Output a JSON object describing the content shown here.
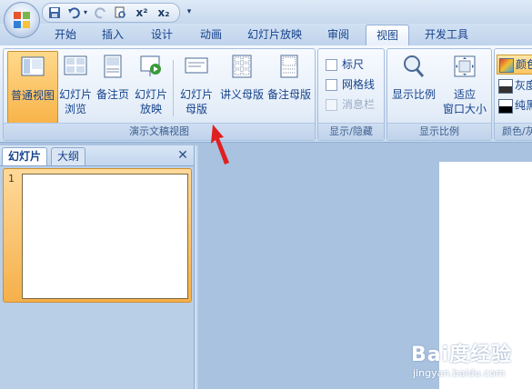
{
  "quick_access": {
    "save_icon": "save-icon",
    "undo_icon": "undo-icon",
    "redo_icon": "redo-icon",
    "print_preview_icon": "print-preview-icon",
    "superscript_label": "x²",
    "subscript_label": "x₂",
    "customize_icon": "chevron-down-icon"
  },
  "tabs": [
    {
      "label": "开始"
    },
    {
      "label": "插入"
    },
    {
      "label": "设计"
    },
    {
      "label": "动画"
    },
    {
      "label": "幻灯片放映"
    },
    {
      "label": "审阅"
    },
    {
      "label": "视图",
      "active": true
    },
    {
      "label": "开发工具"
    }
  ],
  "ribbon": {
    "presentation_views": {
      "label": "演示文稿视图",
      "buttons": {
        "normal": {
          "label": "普通视图",
          "icon": "normal-view-icon",
          "active": true
        },
        "sorter": {
          "line1": "幻灯片",
          "line2": "浏览",
          "icon": "slide-sorter-icon"
        },
        "notes": {
          "label": "备注页",
          "icon": "notes-page-icon"
        },
        "show": {
          "line1": "幻灯片",
          "line2": "放映",
          "icon": "slide-show-icon"
        },
        "slide_master": {
          "line1": "幻灯片",
          "line2": "母版",
          "icon": "slide-master-icon"
        },
        "handout_master": {
          "label": "讲义母版",
          "icon": "handout-master-icon"
        },
        "notes_master": {
          "label": "备注母版",
          "icon": "notes-master-icon"
        }
      }
    },
    "show_hide": {
      "label": "显示/隐藏",
      "ruler": {
        "label": "标尺",
        "checked": false
      },
      "gridlines": {
        "label": "网格线",
        "checked": false
      },
      "message_bar": {
        "label": "消息栏",
        "checked": false,
        "disabled": true
      }
    },
    "zoom": {
      "label": "显示比例",
      "zoom_btn": {
        "label": "显示比例",
        "icon": "zoom-icon"
      },
      "fit_btn": {
        "line1": "适应",
        "line2": "窗口大小",
        "icon": "fit-to-window-icon"
      }
    },
    "color": {
      "label": "颜色/灰",
      "color_btn": {
        "label": "颜色",
        "swatch": "#d04a2a"
      },
      "gray_btn": {
        "label": "灰度",
        "swatch": "#8a8a8a"
      },
      "bw_btn": {
        "label": "纯黑",
        "swatch": "#000000"
      }
    }
  },
  "left_panel": {
    "tabs": [
      {
        "label": "幻灯片",
        "active": true
      },
      {
        "label": "大纲"
      }
    ],
    "close_label": "✕",
    "slide_number": "1"
  },
  "watermark": {
    "line1": "Bai度经验",
    "line2": "jingyan.baidu.com"
  },
  "colors": {
    "accent": "#15428b",
    "active_button": "#f8b44a",
    "arrow": "#e02020"
  }
}
